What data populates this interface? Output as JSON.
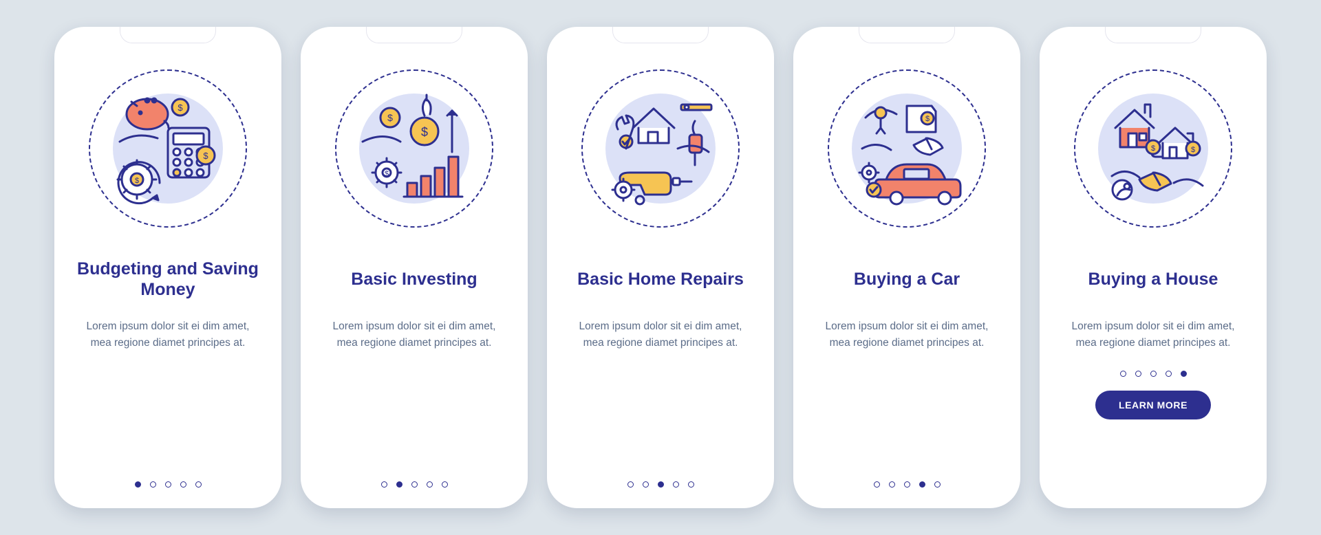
{
  "colors": {
    "primary": "#2d2f8f",
    "accent_yellow": "#f6c453",
    "accent_coral": "#f2836b",
    "bg": "#dde4ea",
    "blob": "#dce1f7",
    "body_text": "#5b6c88"
  },
  "cta_label": "LEARN MORE",
  "screens": [
    {
      "icon_name": "budgeting-icon",
      "title": "Budgeting and Saving Money",
      "body": "Lorem ipsum dolor sit ei dim amet, mea regione diamet principes at.",
      "active_dot": 0,
      "has_cta": false
    },
    {
      "icon_name": "investing-icon",
      "title": "Basic Investing",
      "body": "Lorem ipsum dolor sit ei dim amet, mea regione diamet principes at.",
      "active_dot": 1,
      "has_cta": false
    },
    {
      "icon_name": "home-repairs-icon",
      "title": "Basic Home Repairs",
      "body": "Lorem ipsum dolor sit ei dim amet, mea regione diamet principes at.",
      "active_dot": 2,
      "has_cta": false
    },
    {
      "icon_name": "buying-car-icon",
      "title": "Buying a Car",
      "body": "Lorem ipsum dolor sit ei dim amet, mea regione diamet principes at.",
      "active_dot": 3,
      "has_cta": false
    },
    {
      "icon_name": "buying-house-icon",
      "title": "Buying a House",
      "body": "Lorem ipsum dolor sit ei dim amet, mea regione diamet principes at.",
      "active_dot": 4,
      "has_cta": true
    }
  ]
}
